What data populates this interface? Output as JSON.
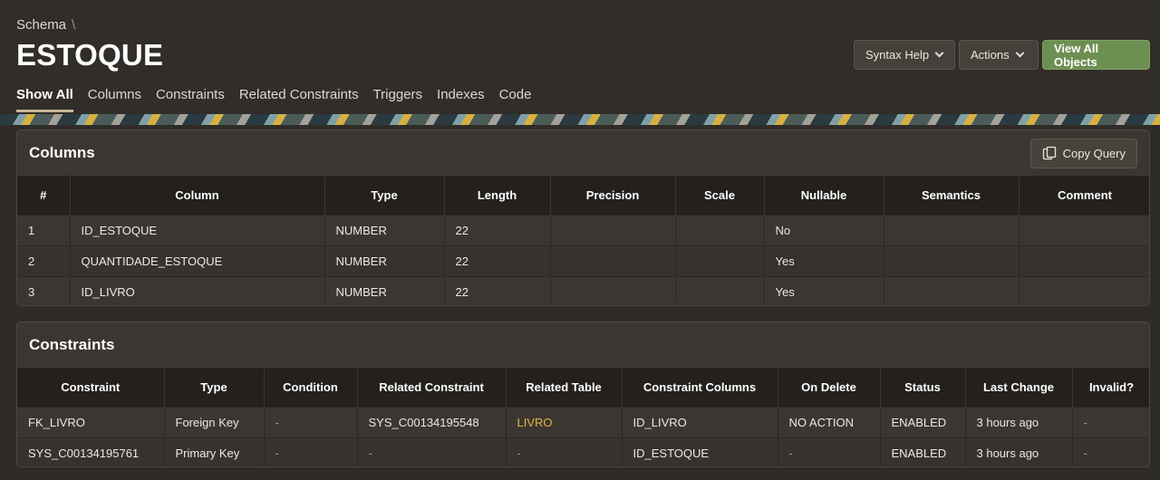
{
  "breadcrumb": {
    "parent": "Schema",
    "separator": "\\"
  },
  "title": "ESTOQUE",
  "buttons": {
    "syntax_help": "Syntax Help",
    "actions": "Actions",
    "view_all": "View All Objects"
  },
  "tabs": [
    "Show All",
    "Columns",
    "Constraints",
    "Related Constraints",
    "Triggers",
    "Indexes",
    "Code"
  ],
  "columns_region": {
    "title": "Columns",
    "copy_button": "Copy Query",
    "headers": [
      "#",
      "Column",
      "Type",
      "Length",
      "Precision",
      "Scale",
      "Nullable",
      "Semantics",
      "Comment"
    ],
    "rows": [
      [
        "1",
        "ID_ESTOQUE",
        "NUMBER",
        "22",
        "",
        "",
        "No",
        "",
        ""
      ],
      [
        "2",
        "QUANTIDADE_ESTOQUE",
        "NUMBER",
        "22",
        "",
        "",
        "Yes",
        "",
        ""
      ],
      [
        "3",
        "ID_LIVRO",
        "NUMBER",
        "22",
        "",
        "",
        "Yes",
        "",
        ""
      ]
    ]
  },
  "constraints_region": {
    "title": "Constraints",
    "headers": [
      "Constraint",
      "Type",
      "Condition",
      "Related Constraint",
      "Related Table",
      "Constraint Columns",
      "On Delete",
      "Status",
      "Last Change",
      "Invalid?"
    ],
    "rows": [
      [
        "FK_LIVRO",
        "Foreign Key",
        "-",
        "SYS_C00134195548",
        "LIVRO",
        "ID_LIVRO",
        "NO ACTION",
        "ENABLED",
        "3 hours ago",
        "-"
      ],
      [
        "SYS_C00134195761",
        "Primary Key",
        "-",
        "-",
        "-",
        "ID_ESTOQUE",
        "-",
        "ENABLED",
        "3 hours ago",
        "-"
      ]
    ]
  }
}
